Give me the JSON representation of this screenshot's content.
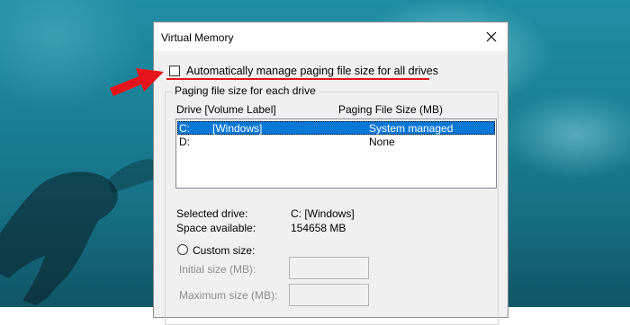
{
  "dialog": {
    "title": "Virtual Memory",
    "close_glyph": "✕"
  },
  "auto_manage": {
    "label": "Automatically manage paging file size for all drives",
    "checked": false
  },
  "group": {
    "legend": "Paging file size for each drive",
    "columns": {
      "drive": "Drive  [Volume Label]",
      "size": "Paging File Size (MB)"
    },
    "rows": [
      {
        "drive": "C:",
        "label": "[Windows]",
        "size": "System managed",
        "selected": true
      },
      {
        "drive": "D:",
        "label": "",
        "size": "None",
        "selected": false
      }
    ]
  },
  "details": {
    "selected_drive_label": "Selected drive:",
    "selected_drive_value": "C:  [Windows]",
    "space_label": "Space available:",
    "space_value": "154658 MB"
  },
  "custom": {
    "label": "Custom size:",
    "initial_label": "Initial size (MB):",
    "maximum_label": "Maximum size (MB):",
    "initial_value": "",
    "maximum_value": ""
  },
  "annotation": {
    "arrow_color": "#e8141b",
    "icons": [
      "close-icon",
      "red-arrow-annotation"
    ]
  },
  "colors": {
    "selection": "#0a78d7",
    "underline": "#e8141b"
  }
}
